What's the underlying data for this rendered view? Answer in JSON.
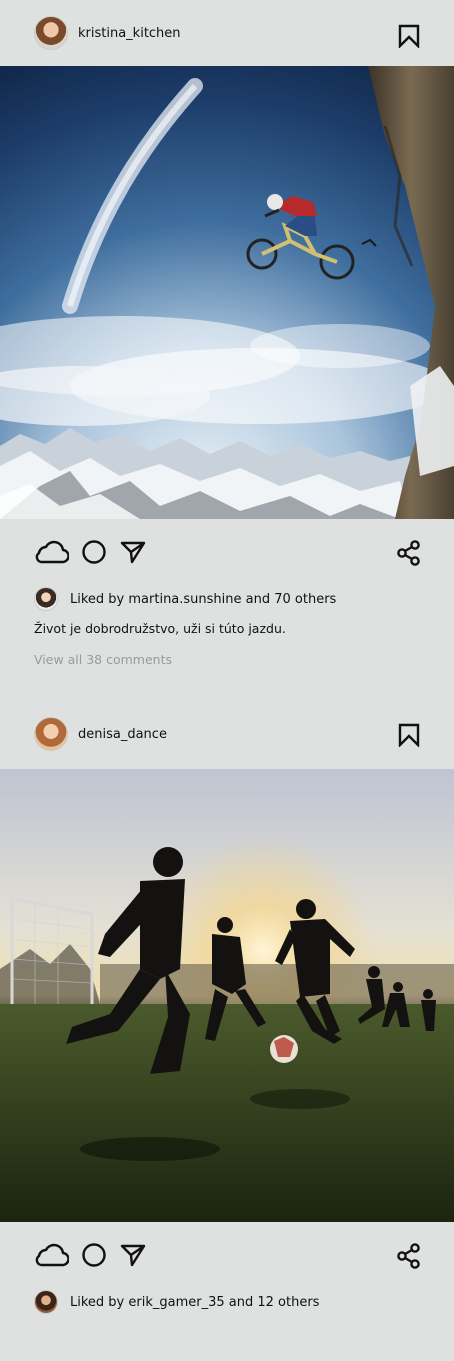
{
  "posts": [
    {
      "username": "kristina_kitchen",
      "image_alt": "Mountain biker jumping over snowy mountains",
      "liked_by_text": "Liked by martina.sunshine and 70 others",
      "caption": "Život je dobrodružstvo, uži si túto jazdu.",
      "comments_link": "View all 38 comments"
    },
    {
      "username": "denisa_dance",
      "image_alt": "Kids playing football at sunset",
      "liked_by_text": "Liked by erik_gamer_35 and 12 others"
    }
  ],
  "icons": {
    "bookmark": "bookmark-icon",
    "like": "cloud-icon",
    "comment": "circle-icon",
    "send": "send-icon",
    "share": "share-icon"
  },
  "colors": {
    "background": "#dfe1e1",
    "text": "#111111",
    "muted": "#9a9a9a"
  }
}
